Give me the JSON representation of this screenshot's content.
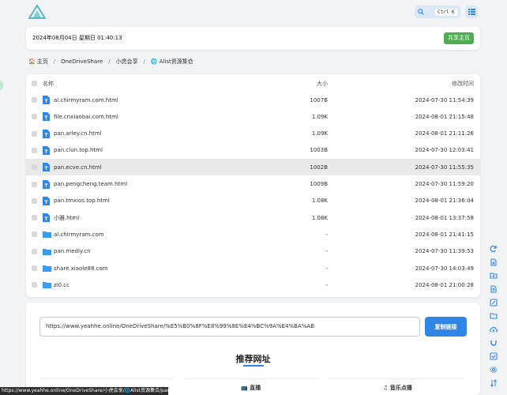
{
  "header": {
    "search_shortcut": "Ctrl K"
  },
  "notice": {
    "datetime": "2024年08月04日 星期日 01:40:13",
    "share_home_label": "共享主页"
  },
  "breadcrumb": {
    "items": [
      "主页",
      "OneDriveShare",
      "小虎会享",
      "Alist资源集合"
    ],
    "separator": "/"
  },
  "list": {
    "headers": {
      "name": "名称",
      "size": "大小",
      "modified": "修改时间"
    },
    "rows": [
      {
        "name": "al.chirmyram.com.html",
        "size": "1007B",
        "modified": "2024-07-30 11:54:39",
        "type": "file"
      },
      {
        "name": "file.cnxiaobai.com.html",
        "size": "1.09K",
        "modified": "2024-08-01 21:15:48",
        "type": "file"
      },
      {
        "name": "pan.arley.cn.html",
        "size": "1.09K",
        "modified": "2024-08-01 21:11:26",
        "type": "file"
      },
      {
        "name": "pan.clun.top.html",
        "size": "1003B",
        "modified": "2024-07-30 12:03:41",
        "type": "file"
      },
      {
        "name": "pan.ecve.cn.html",
        "size": "1002B",
        "modified": "2024-07-30 11:55:35",
        "type": "file"
      },
      {
        "name": "pan.pengcheng.team.html",
        "size": "1009B",
        "modified": "2024-07-30 11:59:20",
        "type": "file"
      },
      {
        "name": "pan.tmxios.top.html",
        "size": "1.08K",
        "modified": "2024-08-01 21:36:04",
        "type": "file"
      },
      {
        "name": "小雅.html",
        "size": "1.08K",
        "modified": "2024-08-01 13:37:58",
        "type": "file"
      },
      {
        "name": "al.chirmyram.com",
        "size": "-",
        "modified": "2024-08-01 21:41:15",
        "type": "folder"
      },
      {
        "name": "pan.mediy.cn",
        "size": "-",
        "modified": "2024-07-30 11:39:53",
        "type": "folder"
      },
      {
        "name": "share.xiaole88.com",
        "size": "-",
        "modified": "2024-07-30 14:03:49",
        "type": "folder"
      },
      {
        "name": "zi0.cc",
        "size": "-",
        "modified": "2024-08-01 21:00:28",
        "type": "folder"
      }
    ]
  },
  "share": {
    "link": "https://www.yeahhe.online/OneDriveShare/%E5%B0%8F%E8%99%8E%E4%BC%9A%E4%BA%AB",
    "copy_label": "复制链接",
    "recommend_title": "推荐网址",
    "categories": [
      "直播",
      "音乐点播"
    ]
  },
  "statusbar": {
    "url": "https://www.yeahhe.online/OneDriveShare/小虎会享/🌐Alist资源集合/pan.ecve.cn.ht..."
  },
  "colors": {
    "accent": "#2f86e6",
    "share_home": "#4caf50",
    "file_icon": "#2f86e6",
    "folder_icon": "#3b9cf0"
  }
}
